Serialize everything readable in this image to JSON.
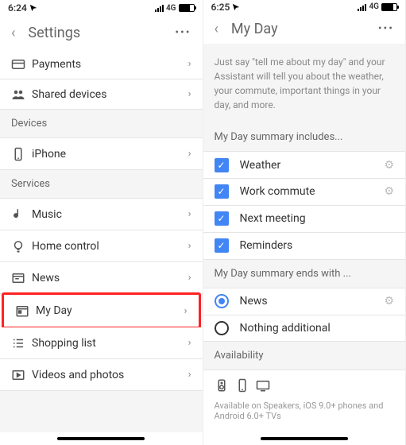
{
  "left": {
    "time": "6:24",
    "network": "4G",
    "title": "Settings",
    "rows": {
      "payments": "Payments",
      "shared_devices": "Shared devices"
    },
    "sections": {
      "devices": "Devices",
      "services": "Services"
    },
    "devices": {
      "iphone": "iPhone"
    },
    "services": {
      "music": "Music",
      "home": "Home control",
      "news": "News",
      "myday": "My Day",
      "shopping": "Shopping list",
      "videos": "Videos and photos"
    }
  },
  "right": {
    "time": "6:25",
    "network": "4G",
    "title": "My Day",
    "help": "Just say \"tell me about my day\" and your Assistant will tell you about the weather, your commute, important things in your day, and more.",
    "sections": {
      "includes": "My Day summary includes...",
      "ends": "My Day summary ends with ...",
      "avail": "Availability"
    },
    "items": {
      "weather": "Weather",
      "commute": "Work commute",
      "meeting": "Next meeting",
      "reminders": "Reminders",
      "news": "News",
      "nothing": "Nothing additional"
    },
    "avail_text": "Available on Speakers, iOS 9.0+ phones and Android 6.0+ TVs"
  }
}
